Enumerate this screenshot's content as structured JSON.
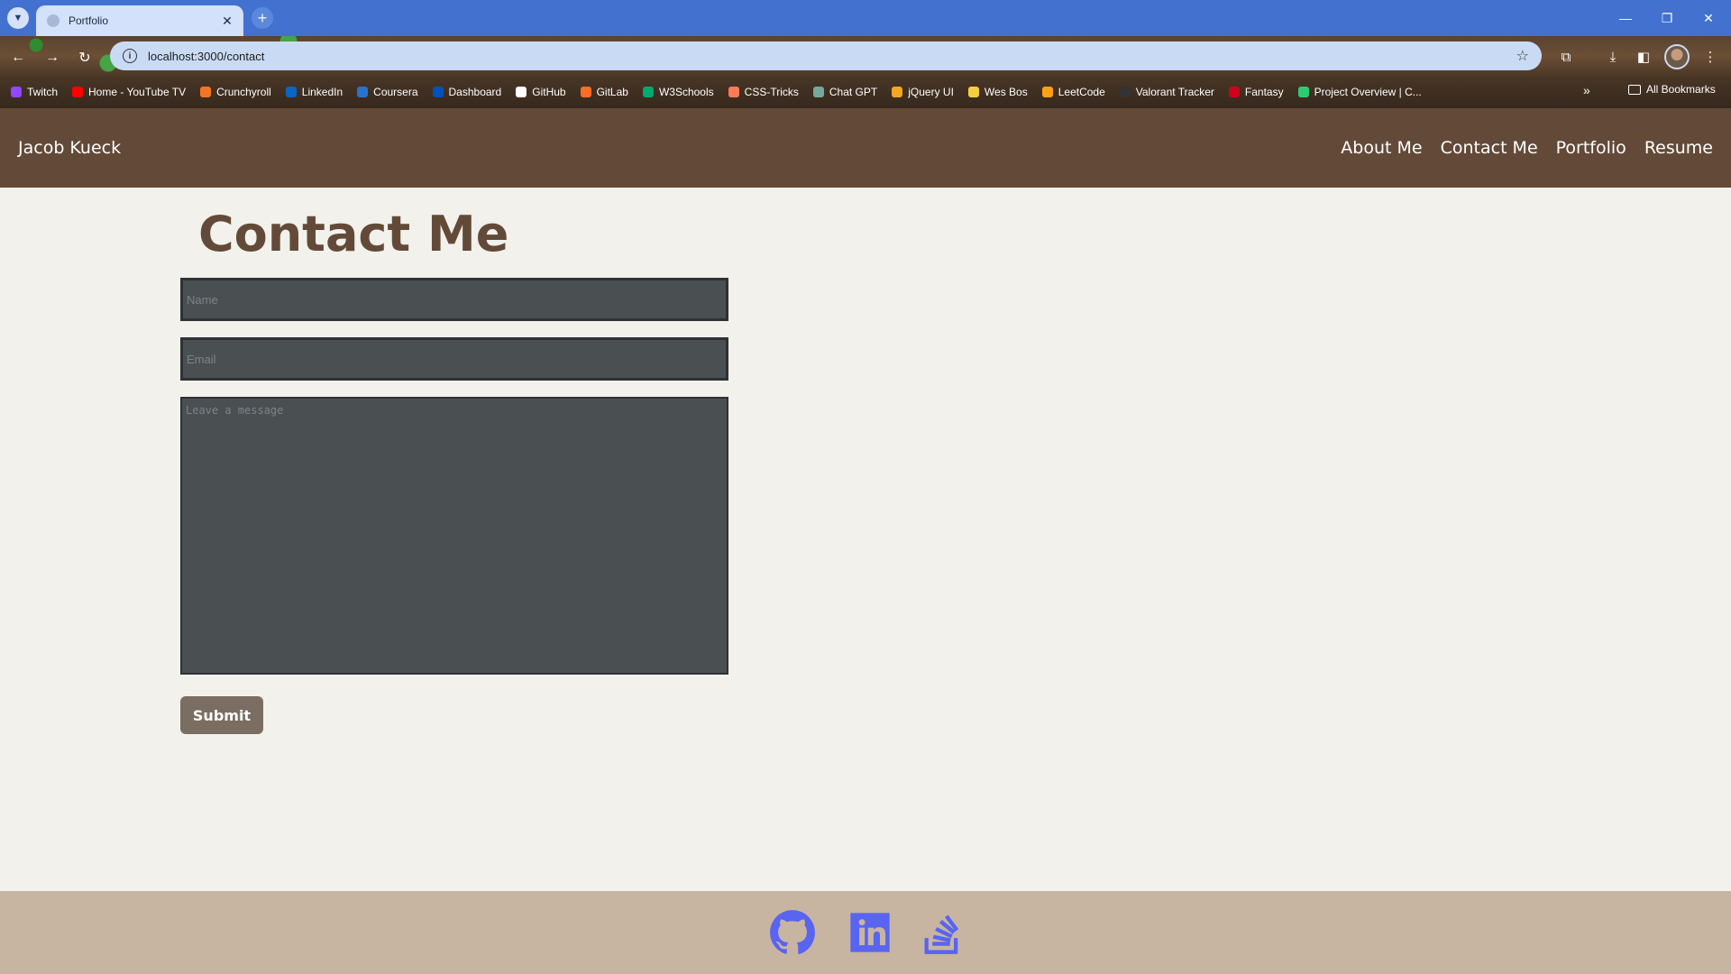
{
  "browser": {
    "tab_title": "Portfolio",
    "tab_close": "✕",
    "new_tab": "+",
    "url": "localhost:3000/contact",
    "window_controls": {
      "minimize": "—",
      "restore": "❐",
      "close": "✕"
    },
    "bookmarks": [
      {
        "label": "Twitch",
        "color": "#9146ff"
      },
      {
        "label": "Home - YouTube TV",
        "color": "#ff0000"
      },
      {
        "label": "Crunchyroll",
        "color": "#f47521"
      },
      {
        "label": "LinkedIn",
        "color": "#0a66c2"
      },
      {
        "label": "Coursera",
        "color": "#2a73cc"
      },
      {
        "label": "Dashboard",
        "color": "#0051ba"
      },
      {
        "label": "GitHub",
        "color": "#ffffff"
      },
      {
        "label": "GitLab",
        "color": "#fc6d26"
      },
      {
        "label": "W3Schools",
        "color": "#04aa6d"
      },
      {
        "label": "CSS-Tricks",
        "color": "#ff7a59"
      },
      {
        "label": "Chat GPT",
        "color": "#74aa9c"
      },
      {
        "label": "jQuery UI",
        "color": "#f5a623"
      },
      {
        "label": "Wes Bos",
        "color": "#f4d03f"
      },
      {
        "label": "LeetCode",
        "color": "#ffa116"
      },
      {
        "label": "Valorant Tracker",
        "color": "#333333"
      },
      {
        "label": "Fantasy",
        "color": "#d0021b"
      },
      {
        "label": "Project Overview | C...",
        "color": "#2ecc71"
      }
    ],
    "more_bookmarks": "»",
    "all_bookmarks": "All Bookmarks"
  },
  "site": {
    "brand": "Jacob Kueck",
    "nav": [
      "About Me",
      "Contact Me",
      "Portfolio",
      "Resume"
    ]
  },
  "contact": {
    "title": "Contact Me",
    "name_placeholder": "Name",
    "email_placeholder": "Email",
    "message_placeholder": "Leave a message",
    "submit_label": "Submit"
  },
  "footer": {
    "icons": [
      "github-icon",
      "linkedin-icon",
      "stackoverflow-icon"
    ],
    "icon_color": "#5964f0"
  },
  "colors": {
    "header_bg": "#634a38",
    "page_bg": "#f2f1ec",
    "input_bg": "#4a4f52",
    "button_bg": "#7a6e63",
    "footer_bg": "#c7b5a2"
  }
}
